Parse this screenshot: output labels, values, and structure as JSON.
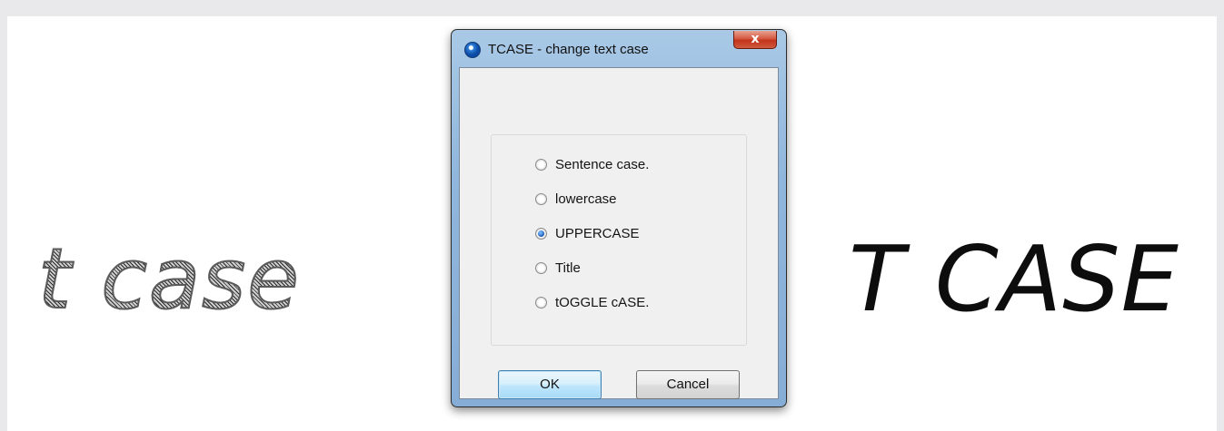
{
  "illustration": {
    "before_text": "t case",
    "after_text": "T CASE"
  },
  "dialog": {
    "title": "TCASE - change text case",
    "close_glyph": "x",
    "app_icon": "autocad-app-icon",
    "options": [
      {
        "label": "Sentence case.",
        "checked": false
      },
      {
        "label": "lowercase",
        "checked": false
      },
      {
        "label": "UPPERCASE",
        "checked": true
      },
      {
        "label": "Title",
        "checked": false
      },
      {
        "label": "tOGGLE cASE.",
        "checked": false
      }
    ],
    "ok_label": "OK",
    "cancel_label": "Cancel"
  },
  "colors": {
    "titlebar": "#a9c9e6",
    "close_button": "#c2331c",
    "default_button_border": "#3c7fb1"
  }
}
